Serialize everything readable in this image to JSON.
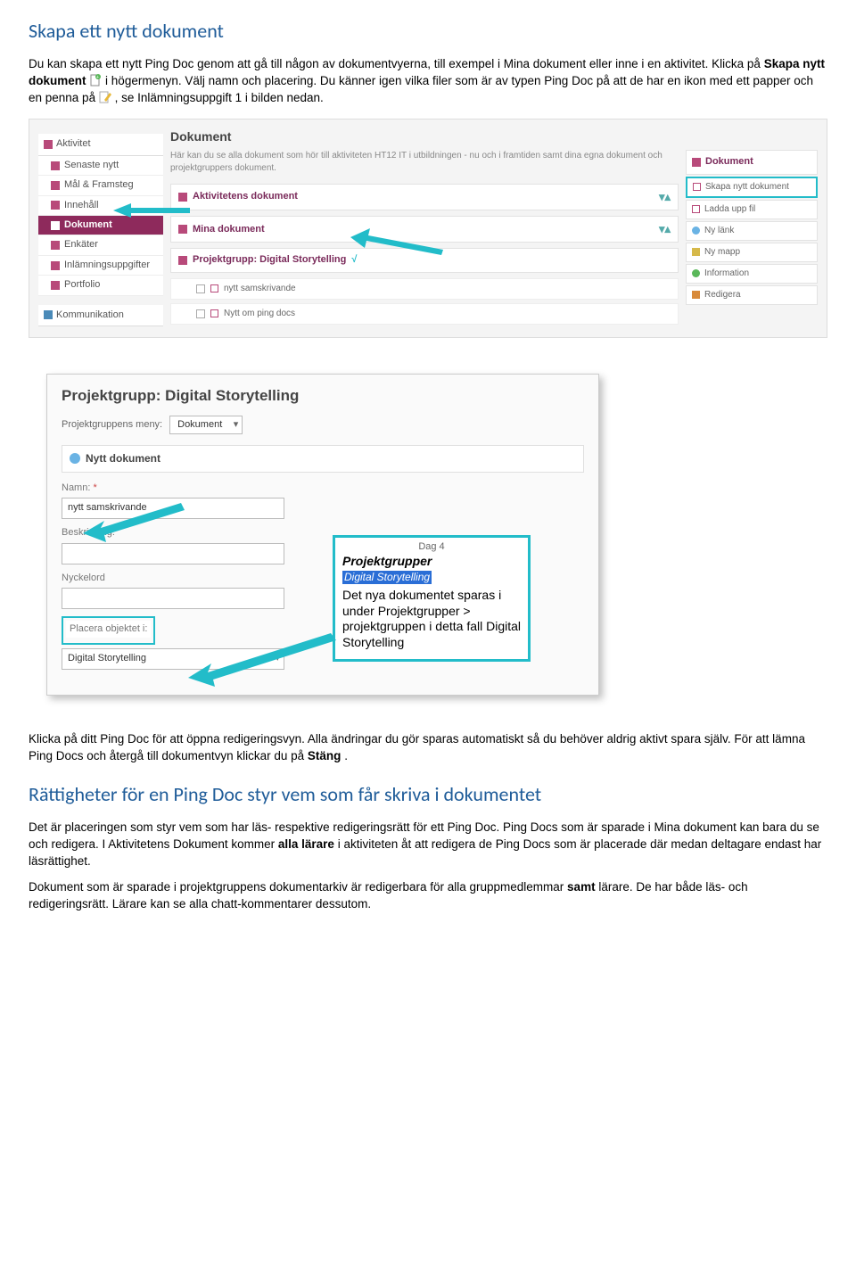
{
  "section1": {
    "heading": "Skapa ett nytt dokument",
    "para1a": "Du kan skapa ett nytt Ping Doc genom att gå till någon av dokumentvyerna, till exempel i Mina dokument eller inne i en aktivitet. Klicka på ",
    "para1b": "Skapa nytt dokument",
    "para1c": " i högermenyn. Välj namn och placering. Du känner igen vilka filer som är av typen Ping Doc på att de har en ikon med ett papper och en penna på ",
    "para1d": ", se Inlämningsuppgift 1 i bilden nedan."
  },
  "shot1": {
    "sidebar_header": "Aktivitet",
    "sidebar_items": [
      "Senaste nytt",
      "Mål & Framsteg",
      "Innehåll",
      "Dokument",
      "Enkäter",
      "Inlämningsuppgifter",
      "Portfolio"
    ],
    "sidebar_bottom": "Kommunikation",
    "main_title": "Dokument",
    "main_desc": "Här kan du se alla dokument som hör till aktiviteten HT12 IT i utbildningen - nu och i framtiden samt dina egna dokument och projektgruppers dokument.",
    "panel1": "Aktivitetens dokument",
    "panel2": "Mina dokument",
    "panel3": "Projektgrupp: Digital Storytelling",
    "panel3_check": "√",
    "sub1": "nytt samskrivande",
    "sub2": "Nytt om ping docs",
    "right_header": "Dokument",
    "r_items": [
      "Skapa nytt dokument",
      "Ladda upp fil",
      "Ny länk",
      "Ny mapp",
      "Information",
      "Redigera"
    ]
  },
  "shot2": {
    "title": "Projektgrupp: Digital Storytelling",
    "menu_label": "Projektgruppens meny:",
    "menu_value": "Dokument",
    "newdoc": "Nytt dokument",
    "lbl_name": "Namn:",
    "req": "*",
    "val_name": "nytt samskrivande",
    "lbl_desc": "Beskrivning:",
    "lbl_key": "Nyckelord",
    "lbl_place": "Placera objektet i:",
    "val_place": "Digital Storytelling",
    "callout_day": "Dag 4",
    "callout_pg": "Projektgrupper",
    "callout_ds": "Digital Storytelling",
    "callout_text": "Det nya dokumentet sparas i under Projektgrupper > projektgruppen i detta fall Digital Storytelling"
  },
  "section2": {
    "para1a": "Klicka på ditt Ping Doc för att öppna redigeringsvyn. Alla ändringar du gör sparas automatiskt så du behöver aldrig aktivt spara själv. För att lämna Ping Docs och återgå till dokumentvyn klickar du på ",
    "para1b": "Stäng",
    "para1c": ".",
    "heading": "Rättigheter för en Ping Doc styr vem som får skriva i dokumentet",
    "para2a": "Det är placeringen som styr vem som har läs- respektive redigeringsrätt för ett Ping Doc. Ping Docs som är sparade i Mina dokument kan bara du se och redigera. I Aktivitetens Dokument kommer ",
    "para2b": "alla lärare",
    "para2c": " i aktiviteten åt att redigera de Ping Docs som är placerade där medan deltagare endast har läsrättighet.",
    "para3a": "Dokument som är sparade i projektgruppens dokumentarkiv är redigerbara för alla gruppmedlemmar ",
    "para3b": "samt",
    "para3c": " lärare. De har både läs- och redigeringsrätt.  Lärare kan se alla chatt-kommentarer dessutom."
  }
}
